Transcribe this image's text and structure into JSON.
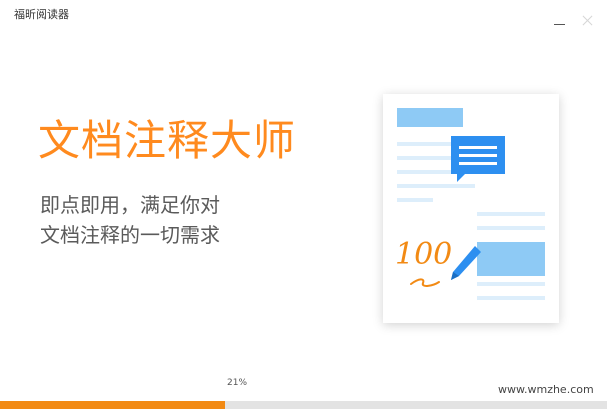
{
  "window": {
    "title": "福昕阅读器",
    "controls": {
      "minimize_icon": "minimize-icon",
      "close_icon": "close-icon"
    }
  },
  "hero": {
    "headline": "文档注释大师",
    "subtext_lines": [
      "即点即用，满足你对",
      "文档注释的一切需求"
    ]
  },
  "illustration": {
    "icon": "annotated-document-icon",
    "handwritten_score": "100"
  },
  "progress": {
    "label": "21%",
    "fraction": 0.37
  },
  "footer": {
    "watermark": "www.wmzhe.com"
  },
  "colors": {
    "accent_orange": "#f28a14",
    "headline_orange": "#ff8a1e",
    "blue": "#2d8ff0",
    "light_blue": "#8ecaf5"
  }
}
